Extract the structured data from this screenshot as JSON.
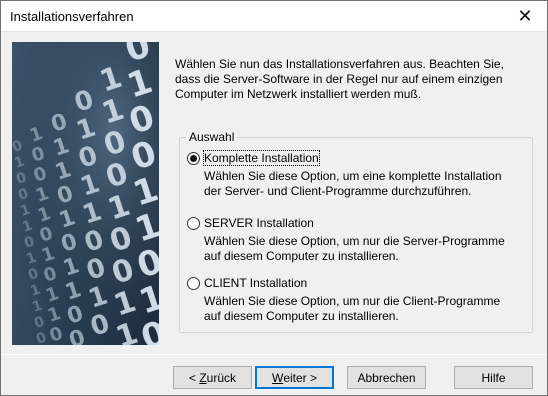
{
  "window": {
    "title": "Installationsverfahren",
    "close_glyph": "✕"
  },
  "description": {
    "line1": "Wählen Sie nun das Installationsverfahren aus. Beachten Sie,",
    "line2": "dass die Server-Software in der Regel nur auf einem einzigen",
    "line3": "Computer im Netzwerk installiert werden muß."
  },
  "group": {
    "label": "Auswahl",
    "options": [
      {
        "label": "Komplette Installation",
        "checked": true,
        "desc1": "Wählen Sie diese Option, um eine komplette Installation",
        "desc2": "der Server- und Client-Programme durchzuführen."
      },
      {
        "label": "SERVER Installation",
        "checked": false,
        "desc1": "Wählen Sie diese Option, um nur die Server-Programme",
        "desc2": "auf diesem Computer zu installieren."
      },
      {
        "label": "CLIENT Installation",
        "checked": false,
        "desc1": "Wählen Sie diese Option, um nur die Client-Programme",
        "desc2": "auf diesem Computer zu installieren."
      }
    ]
  },
  "buttons": {
    "back": {
      "prefix": "< ",
      "mnemonic": "Z",
      "rest": "urück"
    },
    "next": {
      "mnemonic": "W",
      "rest": "eiter >"
    },
    "cancel": "Abbrechen",
    "help": "Hilfe"
  },
  "side_image": {
    "icon": "binary-digits-image",
    "digits": "010011010110"
  }
}
